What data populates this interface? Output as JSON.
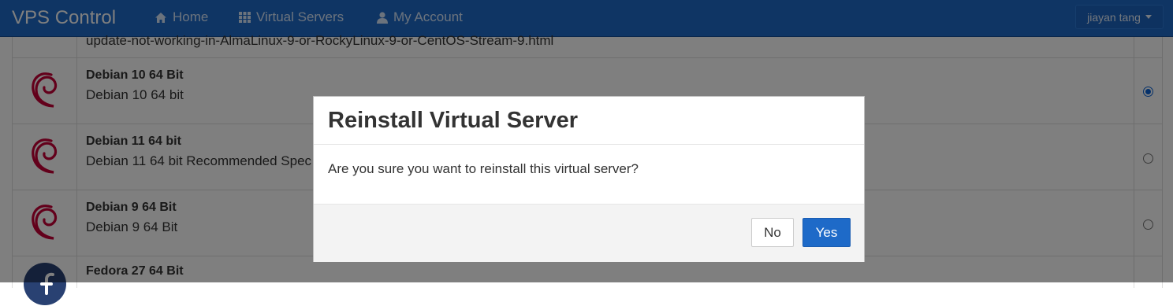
{
  "navbar": {
    "brand": "VPS Control",
    "links": [
      {
        "label": "Home",
        "icon": "home-icon"
      },
      {
        "label": "Virtual Servers",
        "icon": "grid-icon"
      },
      {
        "label": "My Account",
        "icon": "user-icon"
      }
    ],
    "user_menu": "jiayan tang"
  },
  "os_list": {
    "partial_row_text": "update-not-working-in-AlmaLinux-9-or-RockyLinux-9-or-CentOS-Stream-9.html",
    "rows": [
      {
        "title": "Debian 10 64 Bit",
        "description": "Debian 10 64 bit",
        "selected": true,
        "logo": "debian-logo"
      },
      {
        "title": "Debian 11 64 bit",
        "description": "Debian 11 64 bit Recommended Spec",
        "selected": false,
        "logo": "debian-logo"
      },
      {
        "title": "Debian 9 64 Bit",
        "description": "Debian 9 64 Bit",
        "selected": false,
        "logo": "debian-logo"
      },
      {
        "title": "Fedora 27 64 Bit",
        "description": "",
        "selected": false,
        "logo": "fedora-logo"
      }
    ]
  },
  "modal": {
    "title": "Reinstall Virtual Server",
    "message": "Are you sure you want to reinstall this virtual server?",
    "no_label": "No",
    "yes_label": "Yes"
  },
  "colors": {
    "primary": "#1e6ac8",
    "debian_red": "#c70036",
    "fedora_blue": "#294172"
  }
}
